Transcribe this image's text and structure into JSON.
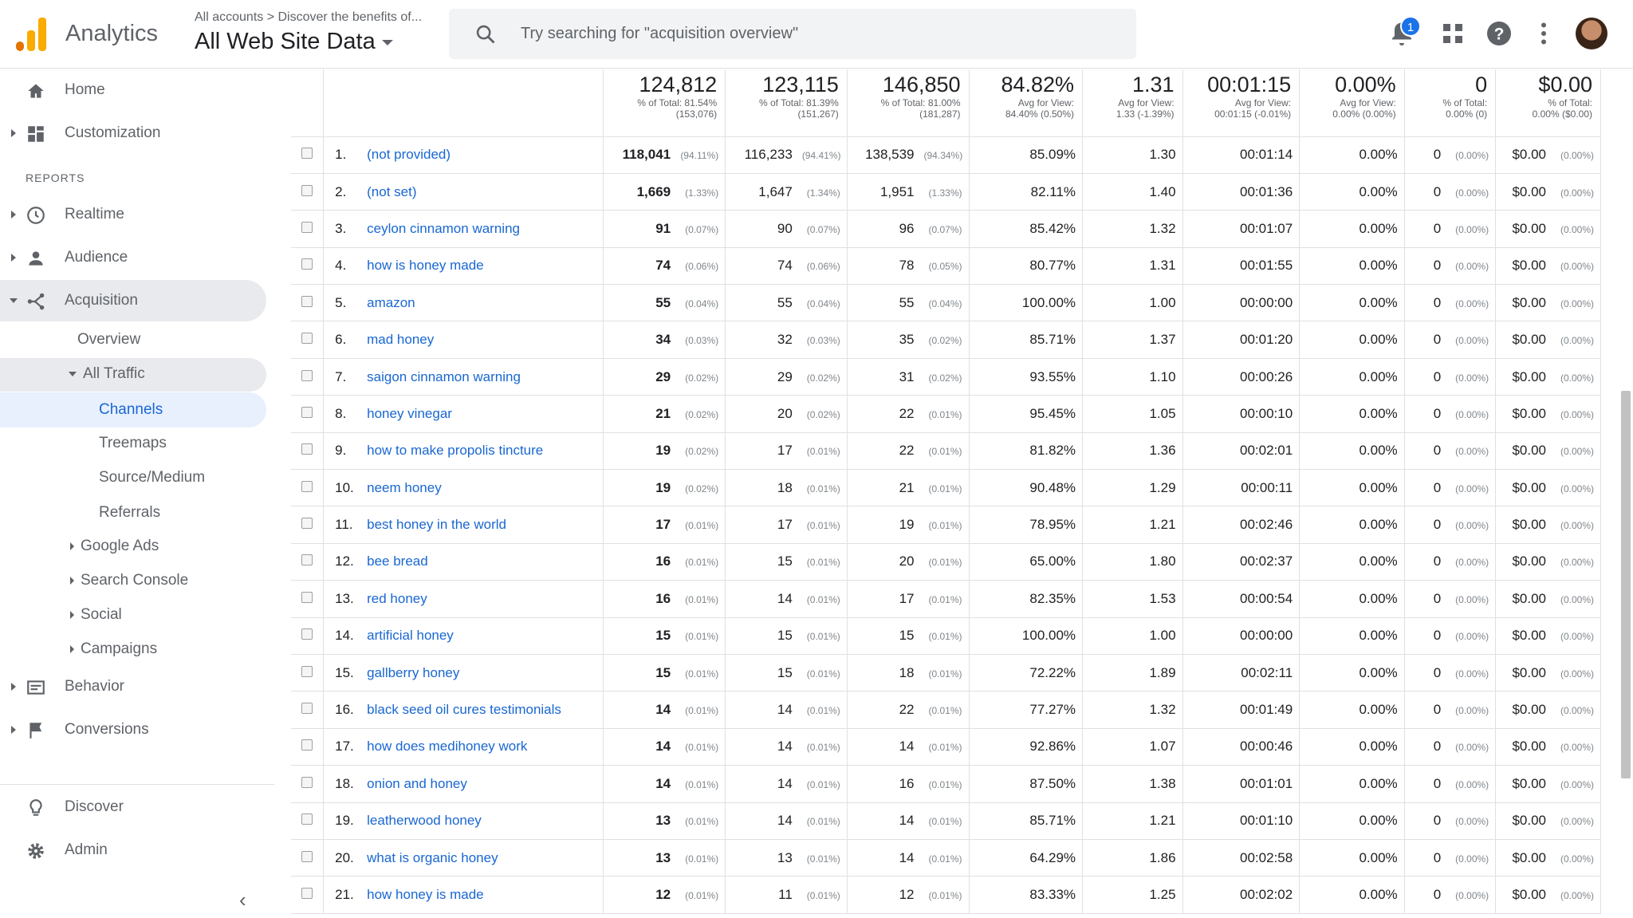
{
  "app": {
    "title": "Analytics",
    "breadcrumb": "All accounts > Discover the benefits of...",
    "view_name": "All Web Site Data",
    "search_placeholder": "Try searching for \"acquisition overview\"",
    "notification_count": "1",
    "brand_colors": [
      "#f9ab00",
      "#e37400"
    ]
  },
  "sidebar": {
    "home": "Home",
    "customization": "Customization",
    "reports_label": "REPORTS",
    "realtime": "Realtime",
    "audience": "Audience",
    "acquisition": "Acquisition",
    "overview": "Overview",
    "all_traffic": "All Traffic",
    "channels": "Channels",
    "treemaps": "Treemaps",
    "source_medium": "Source/Medium",
    "referrals": "Referrals",
    "google_ads": "Google Ads",
    "search_console": "Search Console",
    "social": "Social",
    "campaigns": "Campaigns",
    "behavior": "Behavior",
    "conversions": "Conversions",
    "discover": "Discover",
    "admin": "Admin"
  },
  "totals": [
    {
      "value": "124,812",
      "line1": "% of Total: 81.54%",
      "line2": "(153,076)"
    },
    {
      "value": "123,115",
      "line1": "% of Total: 81.39%",
      "line2": "(151,267)"
    },
    {
      "value": "146,850",
      "line1": "% of Total: 81.00%",
      "line2": "(181,287)"
    },
    {
      "value": "84.82%",
      "line1": "Avg for View:",
      "line2": "84.40% (0.50%)"
    },
    {
      "value": "1.31",
      "line1": "Avg for View:",
      "line2": "1.33 (-1.39%)"
    },
    {
      "value": "00:01:15",
      "line1": "Avg for View:",
      "line2": "00:01:15 (-0.01%)"
    },
    {
      "value": "0.00%",
      "line1": "Avg for View:",
      "line2": "0.00% (0.00%)"
    },
    {
      "value": "0",
      "line1": "% of Total:",
      "line2": "0.00% (0)"
    },
    {
      "value": "$0.00",
      "line1": "% of Total:",
      "line2": "0.00% ($0.00)"
    }
  ],
  "rows": [
    {
      "idx": "1.",
      "kw": "(not provided)",
      "a": "118,041",
      "ap": "(94.11%)",
      "b": "116,233",
      "bp": "(94.41%)",
      "c": "138,539",
      "cp": "(94.34%)",
      "br": "85.09%",
      "pps": "1.30",
      "dur": "00:01:14",
      "cr": "0.00%",
      "g": "0",
      "gp": "(0.00%)",
      "v": "$0.00",
      "vp": "(0.00%)"
    },
    {
      "idx": "2.",
      "kw": "(not set)",
      "a": "1,669",
      "ap": "(1.33%)",
      "b": "1,647",
      "bp": "(1.34%)",
      "c": "1,951",
      "cp": "(1.33%)",
      "br": "82.11%",
      "pps": "1.40",
      "dur": "00:01:36",
      "cr": "0.00%",
      "g": "0",
      "gp": "(0.00%)",
      "v": "$0.00",
      "vp": "(0.00%)"
    },
    {
      "idx": "3.",
      "kw": "ceylon cinnamon warning",
      "a": "91",
      "ap": "(0.07%)",
      "b": "90",
      "bp": "(0.07%)",
      "c": "96",
      "cp": "(0.07%)",
      "br": "85.42%",
      "pps": "1.32",
      "dur": "00:01:07",
      "cr": "0.00%",
      "g": "0",
      "gp": "(0.00%)",
      "v": "$0.00",
      "vp": "(0.00%)"
    },
    {
      "idx": "4.",
      "kw": "how is honey made",
      "a": "74",
      "ap": "(0.06%)",
      "b": "74",
      "bp": "(0.06%)",
      "c": "78",
      "cp": "(0.05%)",
      "br": "80.77%",
      "pps": "1.31",
      "dur": "00:01:55",
      "cr": "0.00%",
      "g": "0",
      "gp": "(0.00%)",
      "v": "$0.00",
      "vp": "(0.00%)"
    },
    {
      "idx": "5.",
      "kw": "amazon",
      "a": "55",
      "ap": "(0.04%)",
      "b": "55",
      "bp": "(0.04%)",
      "c": "55",
      "cp": "(0.04%)",
      "br": "100.00%",
      "pps": "1.00",
      "dur": "00:00:00",
      "cr": "0.00%",
      "g": "0",
      "gp": "(0.00%)",
      "v": "$0.00",
      "vp": "(0.00%)"
    },
    {
      "idx": "6.",
      "kw": "mad honey",
      "a": "34",
      "ap": "(0.03%)",
      "b": "32",
      "bp": "(0.03%)",
      "c": "35",
      "cp": "(0.02%)",
      "br": "85.71%",
      "pps": "1.37",
      "dur": "00:01:20",
      "cr": "0.00%",
      "g": "0",
      "gp": "(0.00%)",
      "v": "$0.00",
      "vp": "(0.00%)"
    },
    {
      "idx": "7.",
      "kw": "saigon cinnamon warning",
      "a": "29",
      "ap": "(0.02%)",
      "b": "29",
      "bp": "(0.02%)",
      "c": "31",
      "cp": "(0.02%)",
      "br": "93.55%",
      "pps": "1.10",
      "dur": "00:00:26",
      "cr": "0.00%",
      "g": "0",
      "gp": "(0.00%)",
      "v": "$0.00",
      "vp": "(0.00%)"
    },
    {
      "idx": "8.",
      "kw": "honey vinegar",
      "a": "21",
      "ap": "(0.02%)",
      "b": "20",
      "bp": "(0.02%)",
      "c": "22",
      "cp": "(0.01%)",
      "br": "95.45%",
      "pps": "1.05",
      "dur": "00:00:10",
      "cr": "0.00%",
      "g": "0",
      "gp": "(0.00%)",
      "v": "$0.00",
      "vp": "(0.00%)"
    },
    {
      "idx": "9.",
      "kw": "how to make propolis tincture",
      "a": "19",
      "ap": "(0.02%)",
      "b": "17",
      "bp": "(0.01%)",
      "c": "22",
      "cp": "(0.01%)",
      "br": "81.82%",
      "pps": "1.36",
      "dur": "00:02:01",
      "cr": "0.00%",
      "g": "0",
      "gp": "(0.00%)",
      "v": "$0.00",
      "vp": "(0.00%)"
    },
    {
      "idx": "10.",
      "kw": "neem honey",
      "a": "19",
      "ap": "(0.02%)",
      "b": "18",
      "bp": "(0.01%)",
      "c": "21",
      "cp": "(0.01%)",
      "br": "90.48%",
      "pps": "1.29",
      "dur": "00:00:11",
      "cr": "0.00%",
      "g": "0",
      "gp": "(0.00%)",
      "v": "$0.00",
      "vp": "(0.00%)"
    },
    {
      "idx": "11.",
      "kw": "best honey in the world",
      "a": "17",
      "ap": "(0.01%)",
      "b": "17",
      "bp": "(0.01%)",
      "c": "19",
      "cp": "(0.01%)",
      "br": "78.95%",
      "pps": "1.21",
      "dur": "00:02:46",
      "cr": "0.00%",
      "g": "0",
      "gp": "(0.00%)",
      "v": "$0.00",
      "vp": "(0.00%)"
    },
    {
      "idx": "12.",
      "kw": "bee bread",
      "a": "16",
      "ap": "(0.01%)",
      "b": "15",
      "bp": "(0.01%)",
      "c": "20",
      "cp": "(0.01%)",
      "br": "65.00%",
      "pps": "1.80",
      "dur": "00:02:37",
      "cr": "0.00%",
      "g": "0",
      "gp": "(0.00%)",
      "v": "$0.00",
      "vp": "(0.00%)"
    },
    {
      "idx": "13.",
      "kw": "red honey",
      "a": "16",
      "ap": "(0.01%)",
      "b": "14",
      "bp": "(0.01%)",
      "c": "17",
      "cp": "(0.01%)",
      "br": "82.35%",
      "pps": "1.53",
      "dur": "00:00:54",
      "cr": "0.00%",
      "g": "0",
      "gp": "(0.00%)",
      "v": "$0.00",
      "vp": "(0.00%)"
    },
    {
      "idx": "14.",
      "kw": "artificial honey",
      "a": "15",
      "ap": "(0.01%)",
      "b": "15",
      "bp": "(0.01%)",
      "c": "15",
      "cp": "(0.01%)",
      "br": "100.00%",
      "pps": "1.00",
      "dur": "00:00:00",
      "cr": "0.00%",
      "g": "0",
      "gp": "(0.00%)",
      "v": "$0.00",
      "vp": "(0.00%)"
    },
    {
      "idx": "15.",
      "kw": "gallberry honey",
      "a": "15",
      "ap": "(0.01%)",
      "b": "15",
      "bp": "(0.01%)",
      "c": "18",
      "cp": "(0.01%)",
      "br": "72.22%",
      "pps": "1.89",
      "dur": "00:02:11",
      "cr": "0.00%",
      "g": "0",
      "gp": "(0.00%)",
      "v": "$0.00",
      "vp": "(0.00%)"
    },
    {
      "idx": "16.",
      "kw": "black seed oil cures testimonials",
      "a": "14",
      "ap": "(0.01%)",
      "b": "14",
      "bp": "(0.01%)",
      "c": "22",
      "cp": "(0.01%)",
      "br": "77.27%",
      "pps": "1.32",
      "dur": "00:01:49",
      "cr": "0.00%",
      "g": "0",
      "gp": "(0.00%)",
      "v": "$0.00",
      "vp": "(0.00%)"
    },
    {
      "idx": "17.",
      "kw": "how does medihoney work",
      "a": "14",
      "ap": "(0.01%)",
      "b": "14",
      "bp": "(0.01%)",
      "c": "14",
      "cp": "(0.01%)",
      "br": "92.86%",
      "pps": "1.07",
      "dur": "00:00:46",
      "cr": "0.00%",
      "g": "0",
      "gp": "(0.00%)",
      "v": "$0.00",
      "vp": "(0.00%)"
    },
    {
      "idx": "18.",
      "kw": "onion and honey",
      "a": "14",
      "ap": "(0.01%)",
      "b": "14",
      "bp": "(0.01%)",
      "c": "16",
      "cp": "(0.01%)",
      "br": "87.50%",
      "pps": "1.38",
      "dur": "00:01:01",
      "cr": "0.00%",
      "g": "0",
      "gp": "(0.00%)",
      "v": "$0.00",
      "vp": "(0.00%)"
    },
    {
      "idx": "19.",
      "kw": "leatherwood honey",
      "a": "13",
      "ap": "(0.01%)",
      "b": "14",
      "bp": "(0.01%)",
      "c": "14",
      "cp": "(0.01%)",
      "br": "85.71%",
      "pps": "1.21",
      "dur": "00:01:10",
      "cr": "0.00%",
      "g": "0",
      "gp": "(0.00%)",
      "v": "$0.00",
      "vp": "(0.00%)"
    },
    {
      "idx": "20.",
      "kw": "what is organic honey",
      "a": "13",
      "ap": "(0.01%)",
      "b": "13",
      "bp": "(0.01%)",
      "c": "14",
      "cp": "(0.01%)",
      "br": "64.29%",
      "pps": "1.86",
      "dur": "00:02:58",
      "cr": "0.00%",
      "g": "0",
      "gp": "(0.00%)",
      "v": "$0.00",
      "vp": "(0.00%)"
    },
    {
      "idx": "21.",
      "kw": "how honey is made",
      "a": "12",
      "ap": "(0.01%)",
      "b": "11",
      "bp": "(0.01%)",
      "c": "12",
      "cp": "(0.01%)",
      "br": "83.33%",
      "pps": "1.25",
      "dur": "00:02:02",
      "cr": "0.00%",
      "g": "0",
      "gp": "(0.00%)",
      "v": "$0.00",
      "vp": "(0.00%)"
    }
  ]
}
